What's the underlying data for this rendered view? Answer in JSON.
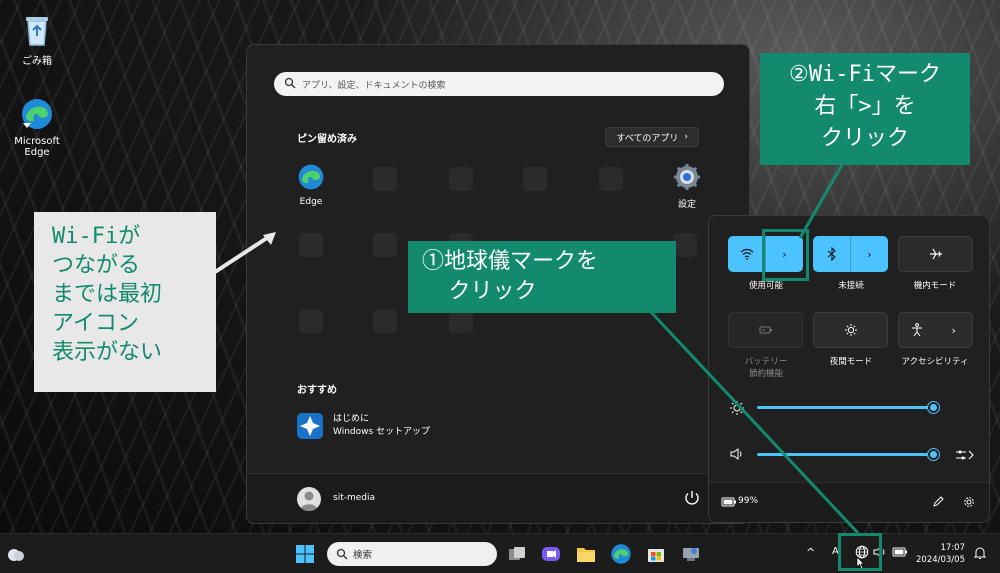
{
  "desktop": {
    "icons": [
      {
        "label": "ごみ箱"
      },
      {
        "label": "Microsoft Edge"
      }
    ]
  },
  "start_menu": {
    "search_placeholder": "アプリ、設定、ドキュメントの検索",
    "pinned_title": "ピン留め済み",
    "all_apps_label": "すべてのアプリ",
    "pinned": [
      {
        "label": "Edge"
      },
      {
        "label": "設定"
      }
    ],
    "recommended_title": "おすすめ",
    "recommended": [
      {
        "title": "はじめに",
        "subtitle": "Windows セットアップ"
      }
    ],
    "user_name": "sit-media"
  },
  "quick_settings": {
    "tiles": [
      {
        "label": "使用可能",
        "state": "on"
      },
      {
        "label": "未接続",
        "state": "on"
      },
      {
        "label": "機内モード",
        "state": "off"
      },
      {
        "label_line1": "バッテリー",
        "label_line2": "節約機能",
        "state": "disabled"
      },
      {
        "label": "夜間モード",
        "state": "off"
      },
      {
        "label": "アクセシビリティ",
        "state": "off"
      }
    ],
    "brightness_percent": 100,
    "volume_percent": 100,
    "battery_text": "99%"
  },
  "taskbar": {
    "search_label": "検索",
    "time": "17:07",
    "date": "2024/03/05",
    "ime_indicator": "A"
  },
  "annotations": {
    "left_note": [
      "Wi-Fiが",
      "つながる",
      "までは最初",
      "アイコン",
      "表示がない"
    ],
    "step1": "①地球儀マークを\n  クリック",
    "step2": "②Wi-Fiマーク\n右「>」を\nクリック"
  },
  "colors": {
    "accent": "#4cc2ff",
    "annotation_green": "#138a6e"
  }
}
